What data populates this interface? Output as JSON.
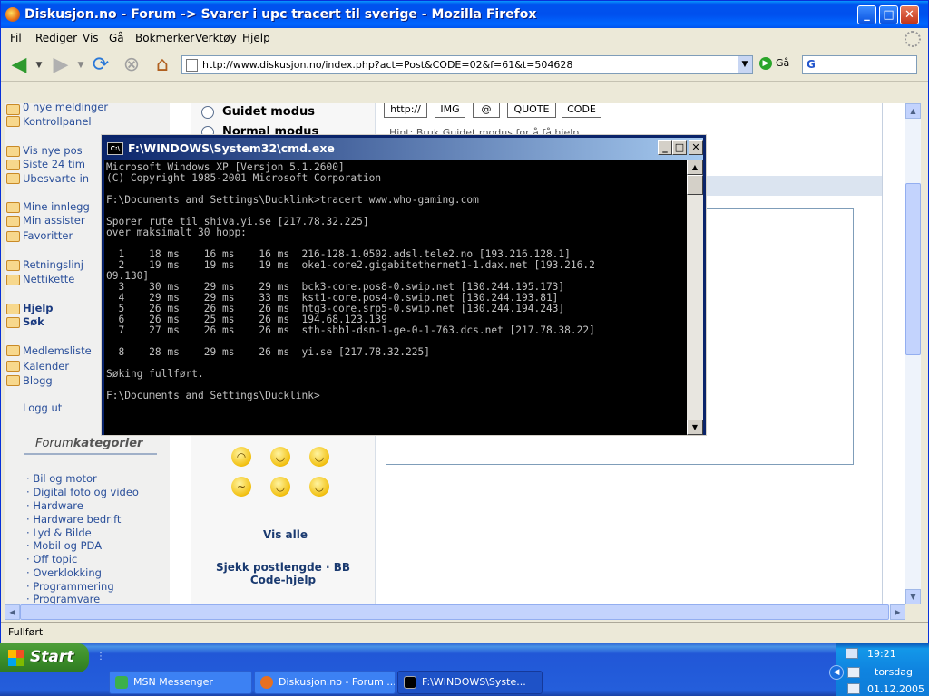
{
  "firefox": {
    "title": "Diskusjon.no - Forum -> Svarer i upc tracert til sverige - Mozilla Firefox",
    "menu": [
      "Fil",
      "Rediger",
      "Vis",
      "Gå",
      "Bokmerker",
      "Verktøy",
      "Hjelp"
    ],
    "url": "http://www.diskusjon.no/index.php?act=Post&CODE=02&f=61&t=504628",
    "go_label": "Gå",
    "search_logo": "G",
    "status": "Fullført"
  },
  "sidebar": {
    "items": [
      "0 nye meldinger",
      "Kontrollpanel",
      "Vis nye pos",
      "Siste 24 tim",
      "Ubesvarte in",
      "Mine innlegg",
      "Min assister",
      "Favoritter",
      "Retningslinj",
      "Nettikette",
      "Hjelp",
      "Søk",
      "Medlemsliste",
      "Kalender",
      "Blogg"
    ],
    "logout": "Logg ut",
    "categories_title_plain": "Forum",
    "categories_title_bold": "kategorier",
    "categories": [
      "Bil og motor",
      "Digital foto og video",
      "Hardware",
      "Hardware bedrift",
      "Lyd & Bilde",
      "Mobil og PDA",
      "Off topic",
      "Overklokking",
      "Programmering",
      "Programvare"
    ]
  },
  "post_form": {
    "mode_guided": "Guidet modus",
    "mode_normal": "Normal modus",
    "buttons": [
      "http://",
      "IMG",
      "@",
      "QUOTE",
      "CODE"
    ],
    "hint": "Hint: Bruk Guidet modus for å få hjelp",
    "show_all": "Vis alle",
    "check_length": "Sjekk postlengde · BB Code-hjelp"
  },
  "cmd": {
    "title": "F:\\WINDOWS\\System32\\cmd.exe",
    "icon_text": "C:\\",
    "lines": [
      "Microsoft Windows XP [Versjon 5.1.2600]",
      "(C) Copyright 1985-2001 Microsoft Corporation",
      "",
      "F:\\Documents and Settings\\Ducklink>tracert www.who-gaming.com",
      "",
      "Sporer rute til shiva.yi.se [217.78.32.225]",
      "over maksimalt 30 hopp:",
      "",
      "  1    18 ms    16 ms    16 ms  216-128-1.0502.adsl.tele2.no [193.216.128.1]",
      "  2    19 ms    19 ms    19 ms  oke1-core2.gigabitethernet1-1.dax.net [193.216.2",
      "09.130]",
      "  3    30 ms    29 ms    29 ms  bck3-core.pos8-0.swip.net [130.244.195.173]",
      "  4    29 ms    29 ms    33 ms  kst1-core.pos4-0.swip.net [130.244.193.81]",
      "  5    26 ms    26 ms    26 ms  htg3-core.srp5-0.swip.net [130.244.194.243]",
      "  6    26 ms    25 ms    26 ms  194.68.123.139",
      "  7    27 ms    26 ms    26 ms  sth-sbb1-dsn-1-ge-0-1-763.dcs.net [217.78.38.22]",
      "",
      "  8    28 ms    29 ms    26 ms  yi.se [217.78.32.225]",
      "",
      "Søking fullført.",
      "",
      "F:\\Documents and Settings\\Ducklink>"
    ]
  },
  "taskbar": {
    "start": "Start",
    "tasks": [
      "MSN Messenger",
      "Diskusjon.no - Forum ...",
      "F:\\WINDOWS\\Syste..."
    ],
    "clock": "19:21",
    "day": "torsdag",
    "date": "01.12.2005"
  }
}
